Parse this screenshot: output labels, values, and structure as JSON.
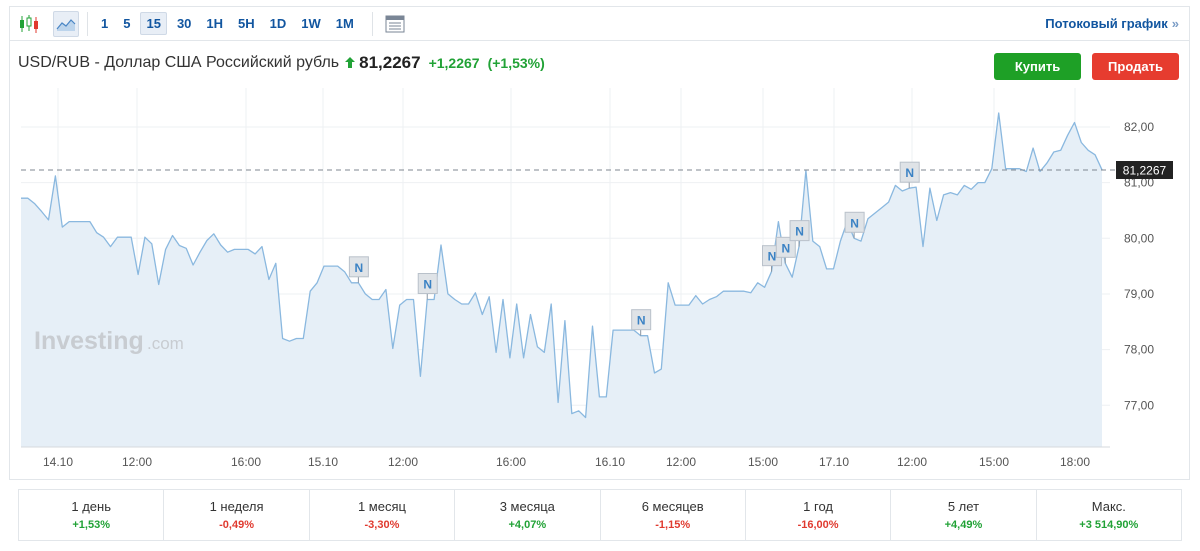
{
  "toolbar": {
    "intervals": [
      {
        "label": "1",
        "active": false
      },
      {
        "label": "5",
        "active": false
      },
      {
        "label": "15",
        "active": true
      },
      {
        "label": "30",
        "active": false
      },
      {
        "label": "1H",
        "active": false
      },
      {
        "label": "5H",
        "active": false
      },
      {
        "label": "1D",
        "active": false
      },
      {
        "label": "1W",
        "active": false
      },
      {
        "label": "1M",
        "active": false
      }
    ],
    "streaming_link": "Потоковый график",
    "streaming_chevron": "»"
  },
  "header": {
    "instrument": "USD/RUB - Доллар США Российский рубль",
    "last_price": "81,2267",
    "change": "+1,2267",
    "change_pct": "(+1,53%)",
    "direction": "up"
  },
  "buttons": {
    "buy": "Купить",
    "sell": "Продать"
  },
  "watermark": {
    "brand": "Investing",
    "suffix": ".com"
  },
  "colors": {
    "line": "#8ab8df",
    "area": "#e6eff7",
    "up": "#21a236",
    "down": "#e03a2f",
    "buy": "#1ea026",
    "sell": "#e63c2f",
    "link": "#1256a0"
  },
  "chart_data": {
    "type": "area",
    "ylim": [
      76.25,
      82.7
    ],
    "y_ticks": [
      "82,00",
      "81,00",
      "80,00",
      "79,00",
      "78,00",
      "77,00"
    ],
    "y_tick_values": [
      82,
      81,
      80,
      79,
      78,
      77
    ],
    "x_ticks": [
      "14.10",
      "12:00",
      "16:00",
      "15.10",
      "12:00",
      "16:00",
      "16.10",
      "12:00",
      "15:00",
      "17.10",
      "12:00",
      "15:00",
      "18:00"
    ],
    "last_value_label": "81,2267",
    "last_value": 81.2267,
    "grid": true,
    "news_marker_label": "N",
    "news_markers_at_index": [
      49,
      59,
      90,
      109,
      111,
      113,
      121,
      129
    ],
    "series": [
      {
        "values": [
          80.72,
          80.72,
          80.62,
          80.48,
          80.33,
          81.12,
          80.2,
          80.3,
          80.3,
          80.3,
          80.3,
          80.1,
          80.02,
          79.85,
          80.02,
          80.02,
          80.02,
          79.35,
          80.02,
          79.9,
          79.17,
          79.8,
          80.05,
          79.87,
          79.82,
          79.52,
          79.75,
          79.96,
          80.08,
          79.88,
          79.75,
          79.8,
          79.8,
          79.8,
          79.72,
          79.85,
          79.26,
          79.55,
          78.2,
          78.15,
          78.2,
          78.2,
          79.05,
          79.2,
          79.5,
          79.5,
          79.5,
          79.4,
          79.2,
          79.2,
          79.0,
          78.9,
          78.9,
          79.08,
          78.02,
          78.8,
          78.9,
          78.9,
          77.52,
          78.9,
          78.9,
          79.88,
          79.0,
          78.9,
          78.82,
          78.82,
          79.02,
          78.63,
          78.95,
          77.95,
          78.9,
          77.85,
          78.82,
          77.85,
          78.63,
          78.05,
          77.95,
          78.82,
          77.05,
          78.52,
          76.85,
          76.9,
          76.78,
          78.42,
          77.15,
          77.15,
          78.35,
          78.35,
          78.35,
          78.35,
          78.25,
          78.25,
          77.58,
          77.65,
          79.2,
          78.8,
          78.8,
          78.8,
          78.97,
          78.82,
          78.9,
          78.95,
          79.05,
          79.05,
          79.05,
          79.05,
          79.02,
          79.2,
          79.12,
          79.4,
          80.3,
          79.55,
          79.3,
          79.85,
          81.22,
          79.95,
          79.85,
          79.45,
          79.45,
          79.95,
          80.3,
          80.0,
          79.95,
          80.35,
          80.45,
          80.55,
          80.65,
          80.95,
          80.85,
          80.9,
          80.92,
          79.85,
          80.9,
          80.32,
          80.78,
          80.82,
          80.78,
          80.95,
          80.88,
          81.0,
          81.0,
          81.25,
          82.25,
          81.25,
          81.25,
          81.25,
          81.2,
          81.62,
          81.2,
          81.35,
          81.55,
          81.58,
          81.85,
          82.08,
          81.72,
          81.58,
          81.5,
          81.23
        ]
      }
    ]
  },
  "period_changes": [
    {
      "label": "1 день",
      "value": "+1,53%",
      "dir": "pos"
    },
    {
      "label": "1 неделя",
      "value": "-0,49%",
      "dir": "neg"
    },
    {
      "label": "1 месяц",
      "value": "-3,30%",
      "dir": "neg"
    },
    {
      "label": "3 месяца",
      "value": "+4,07%",
      "dir": "pos"
    },
    {
      "label": "6 месяцев",
      "value": "-1,15%",
      "dir": "neg"
    },
    {
      "label": "1 год",
      "value": "-16,00%",
      "dir": "neg"
    },
    {
      "label": "5 лет",
      "value": "+4,49%",
      "dir": "pos"
    },
    {
      "label": "Макс.",
      "value": "+3 514,90%",
      "dir": "pos"
    }
  ]
}
